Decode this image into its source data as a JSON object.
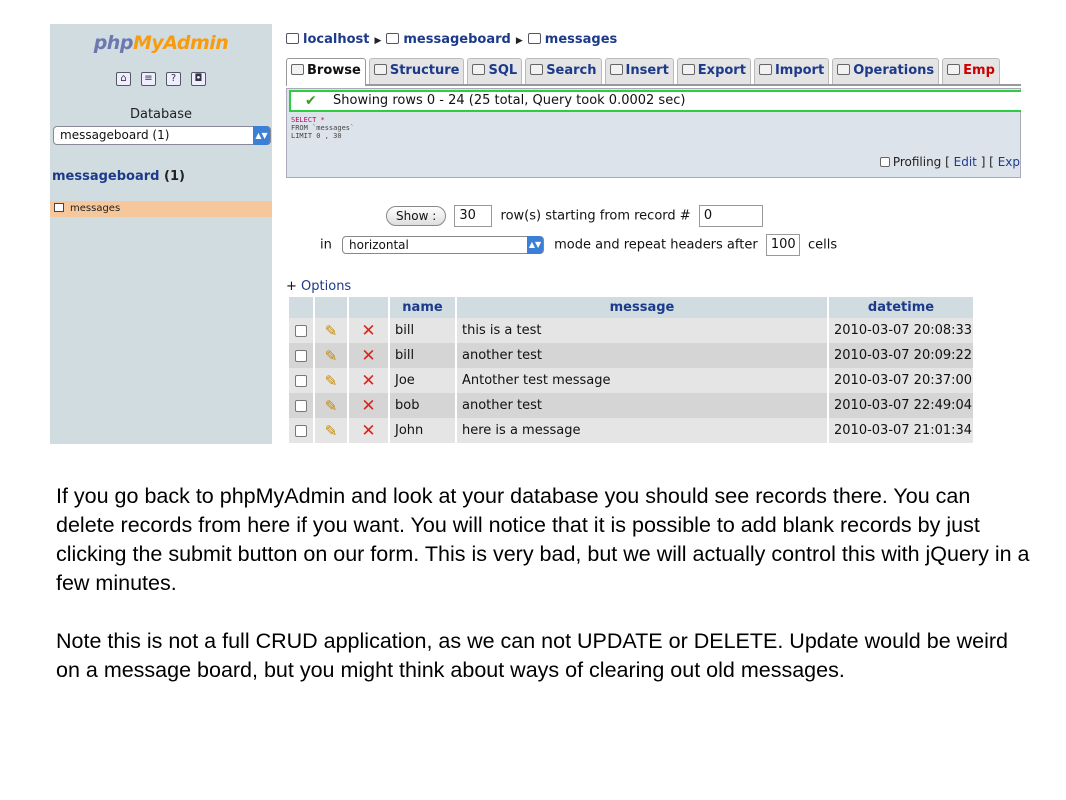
{
  "sidebar": {
    "logo_php": "php",
    "logo_myadmin": "MyAdmin",
    "database_label": "Database",
    "database_selected": "messageboard (1)",
    "db_title": "messageboard",
    "db_count": "(1)",
    "table_item": "messages"
  },
  "breadcrumb": {
    "server": "localhost",
    "database": "messageboard",
    "table": "messages"
  },
  "tabs": [
    {
      "label": "Browse",
      "active": true
    },
    {
      "label": "Structure"
    },
    {
      "label": "SQL"
    },
    {
      "label": "Search"
    },
    {
      "label": "Insert"
    },
    {
      "label": "Export"
    },
    {
      "label": "Import"
    },
    {
      "label": "Operations"
    },
    {
      "label": "Emp"
    }
  ],
  "query": {
    "message": "Showing rows 0 - 24 (25 total, Query took 0.0002 sec)",
    "sql_line1": "SELECT *",
    "sql_line2": "FROM `messages`",
    "sql_line3": "LIMIT 0 , 30",
    "profiling_label": "Profiling",
    "edit_link": "Edit",
    "explain_link": "Exp"
  },
  "nav": {
    "show_button": "Show :",
    "rows_value": "30",
    "rows_text": "row(s) starting from record #",
    "start_value": "0",
    "in_text": "in",
    "mode_value": "horizontal",
    "mode_text": "mode and repeat headers after",
    "repeat_value": "100",
    "cells_text": "cells"
  },
  "options_link": "Options",
  "table": {
    "columns": [
      "name",
      "message",
      "datetime"
    ],
    "rows": [
      {
        "name": "bill",
        "message": "this is a test",
        "datetime": "2010-03-07 20:08:33"
      },
      {
        "name": "bill",
        "message": "another test",
        "datetime": "2010-03-07 20:09:22"
      },
      {
        "name": "Joe",
        "message": "Antother test message",
        "datetime": "2010-03-07 20:37:00"
      },
      {
        "name": "bob",
        "message": "another test",
        "datetime": "2010-03-07 22:49:04"
      },
      {
        "name": "John",
        "message": "here is a message",
        "datetime": "2010-03-07 21:01:34"
      }
    ]
  },
  "caption": {
    "paragraph1": "If you go back to phpMyAdmin and look at your database you should see records there. You can delete records from here if you want. You will notice that it is possible to add blank records by just clicking the submit button on our form. This is very bad, but we will actually control this with jQuery in a few minutes.",
    "paragraph2": "Note this is not a full CRUD application, as we can not UPDATE or DELETE. Update would be weird on a message board, but you might think about ways of clearing out old messages."
  }
}
